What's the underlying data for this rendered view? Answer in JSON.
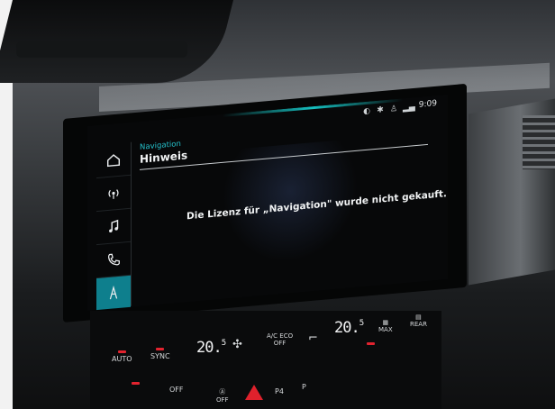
{
  "colors": {
    "accent": "#25c2cc",
    "active_tab": "#0e7f8d",
    "led": "#e2232f"
  },
  "status_bar": {
    "time": "9:09",
    "icons": [
      "voice-icon",
      "bluetooth-icon",
      "person-icon",
      "signal-icon"
    ]
  },
  "sidebar": {
    "items": [
      {
        "name": "home-icon"
      },
      {
        "name": "radio-icon"
      },
      {
        "name": "music-icon"
      },
      {
        "name": "phone-icon"
      },
      {
        "name": "navigation-icon",
        "active": true
      }
    ]
  },
  "header": {
    "app_name": "Navigation",
    "title": "Hinweis"
  },
  "main": {
    "message": "Die Lizenz für „Navigation\" wurde nicht gekauft."
  },
  "climate": {
    "left_temp": "20.",
    "left_temp_sup": "5",
    "right_temp": "20.",
    "right_temp_sup": "5",
    "auto_label": "AUTO",
    "sync_label": "SYNC",
    "off_label": "OFF",
    "ac_label": "A/C",
    "eco_label": "ECO",
    "ac_off_label": "OFF",
    "max_label": "MAX",
    "rear_label": "REAR",
    "p4_label": "P4",
    "pa_label": "P",
    "stop_start_label": "OFF"
  }
}
